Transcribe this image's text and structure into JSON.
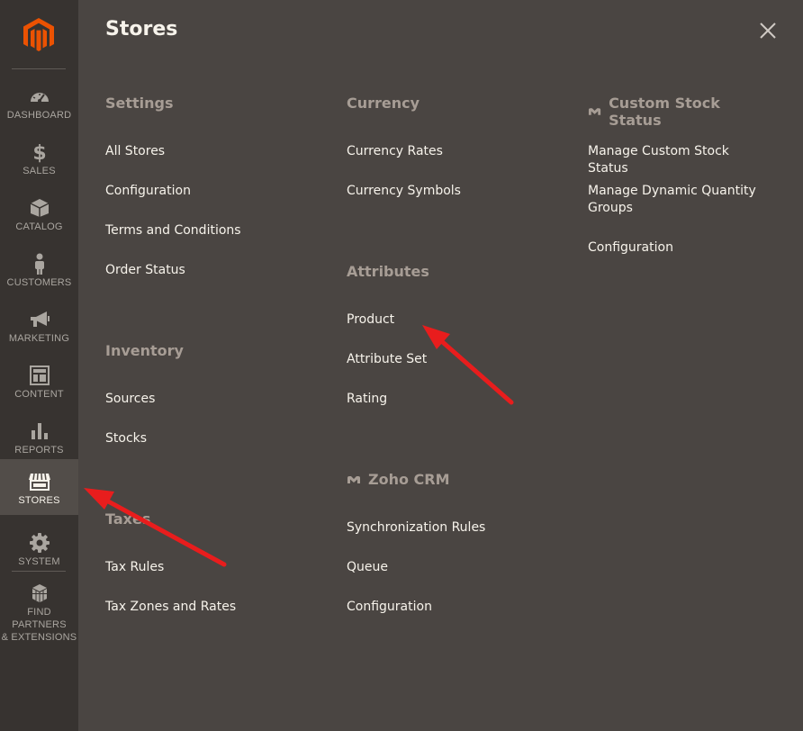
{
  "sidebar": {
    "items": [
      {
        "label": "DASHBOARD",
        "icon": "dashboard-icon"
      },
      {
        "label": "SALES",
        "icon": "dollar-icon"
      },
      {
        "label": "CATALOG",
        "icon": "box-icon"
      },
      {
        "label": "CUSTOMERS",
        "icon": "person-icon"
      },
      {
        "label": "MARKETING",
        "icon": "megaphone-icon"
      },
      {
        "label": "CONTENT",
        "icon": "layout-icon"
      },
      {
        "label": "REPORTS",
        "icon": "bar-chart-icon"
      },
      {
        "label": "STORES",
        "icon": "storefront-icon"
      },
      {
        "label": "SYSTEM",
        "icon": "gear-icon"
      },
      {
        "label_line1": "FIND PARTNERS",
        "label_line2": "& EXTENSIONS",
        "icon": "blocks-icon"
      }
    ]
  },
  "panel": {
    "title": "Stores",
    "groups": {
      "settings": {
        "title": "Settings",
        "links": [
          "All Stores",
          "Configuration",
          "Terms and Conditions",
          "Order Status"
        ]
      },
      "inventory": {
        "title": "Inventory",
        "links": [
          "Sources",
          "Stocks"
        ]
      },
      "taxes": {
        "title": "Taxes",
        "links": [
          "Tax Rules",
          "Tax Zones and Rates"
        ]
      },
      "currency": {
        "title": "Currency",
        "links": [
          "Currency Rates",
          "Currency Symbols"
        ]
      },
      "attributes": {
        "title": "Attributes",
        "links": [
          "Product",
          "Attribute Set",
          "Rating"
        ]
      },
      "zoho": {
        "title": "Zoho CRM",
        "links": [
          "Synchronization Rules",
          "Queue",
          "Configuration"
        ]
      },
      "custom_stock": {
        "title": "Custom Stock Status",
        "links": [
          "Manage Custom Stock Status",
          "Manage Dynamic Quantity Groups",
          "Configuration"
        ]
      }
    }
  },
  "colors": {
    "sidebar_bg": "#373330",
    "panel_bg": "#4a4542",
    "brand_orange": "#eb5202",
    "annotation_arrow": "#e81d1d"
  }
}
